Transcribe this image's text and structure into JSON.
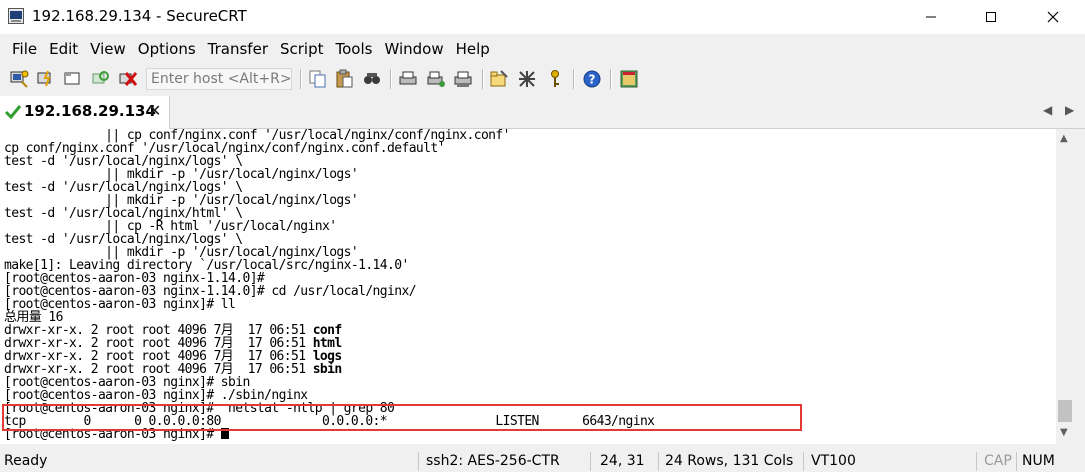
{
  "window": {
    "title": "192.168.29.134 - SecureCRT"
  },
  "menu": [
    "File",
    "Edit",
    "View",
    "Options",
    "Transfer",
    "Script",
    "Tools",
    "Window",
    "Help"
  ],
  "toolbar": {
    "host_placeholder": "Enter host <Alt+R>",
    "icons": [
      "connect-icon",
      "quick-connect-icon",
      "connect-tab-icon",
      "reconnect-icon",
      "disconnect-icon",
      "copy-icon",
      "paste-icon",
      "find-icon",
      "print-icon",
      "print-setup-icon",
      "print-preview-icon",
      "session-options-icon",
      "global-options-icon",
      "keymap-icon",
      "help-icon",
      "sftp-icon"
    ]
  },
  "tab": {
    "label": "192.168.29.134",
    "close": "✕"
  },
  "terminal": {
    "lines": [
      "              || cp conf/nginx.conf '/usr/local/nginx/conf/nginx.conf'",
      "cp conf/nginx.conf '/usr/local/nginx/conf/nginx.conf.default'",
      "test -d '/usr/local/nginx/logs' \\",
      "              || mkdir -p '/usr/local/nginx/logs'",
      "test -d '/usr/local/nginx/logs' \\",
      "              || mkdir -p '/usr/local/nginx/logs'",
      "test -d '/usr/local/nginx/html' \\",
      "              || cp -R html '/usr/local/nginx'",
      "test -d '/usr/local/nginx/logs' \\",
      "              || mkdir -p '/usr/local/nginx/logs'",
      "make[1]: Leaving directory `/usr/local/src/nginx-1.14.0'",
      "[root@centos-aaron-03 nginx-1.14.0]#",
      "[root@centos-aaron-03 nginx-1.14.0]# cd /usr/local/nginx/",
      "[root@centos-aaron-03 nginx]# ll",
      "总用量 16"
    ],
    "dirs": [
      {
        "prefix": "drwxr-xr-x. 2 root root 4096 7月  17 06:51 ",
        "name": "conf"
      },
      {
        "prefix": "drwxr-xr-x. 2 root root 4096 7月  17 06:51 ",
        "name": "html"
      },
      {
        "prefix": "drwxr-xr-x. 2 root root 4096 7月  17 06:51 ",
        "name": "logs"
      },
      {
        "prefix": "drwxr-xr-x. 2 root root 4096 7月  17 06:51 ",
        "name": "sbin"
      }
    ],
    "tail": [
      "[root@centos-aaron-03 nginx]# sbin",
      "[root@centos-aaron-03 nginx]# ./sbin/nginx",
      "[root@centos-aaron-03 nginx]#  netstat -ntlp | grep 80",
      "tcp        0      0 0.0.0.0:80              0.0.0.0:*               LISTEN      6643/nginx",
      "[root@centos-aaron-03 nginx]# "
    ]
  },
  "status": {
    "ready": "Ready",
    "protocol": "ssh2: AES-256-CTR",
    "position": "24,  31",
    "size": "24 Rows, 131 Cols",
    "emulation": "VT100",
    "caps": "CAP",
    "num": "NUM"
  }
}
